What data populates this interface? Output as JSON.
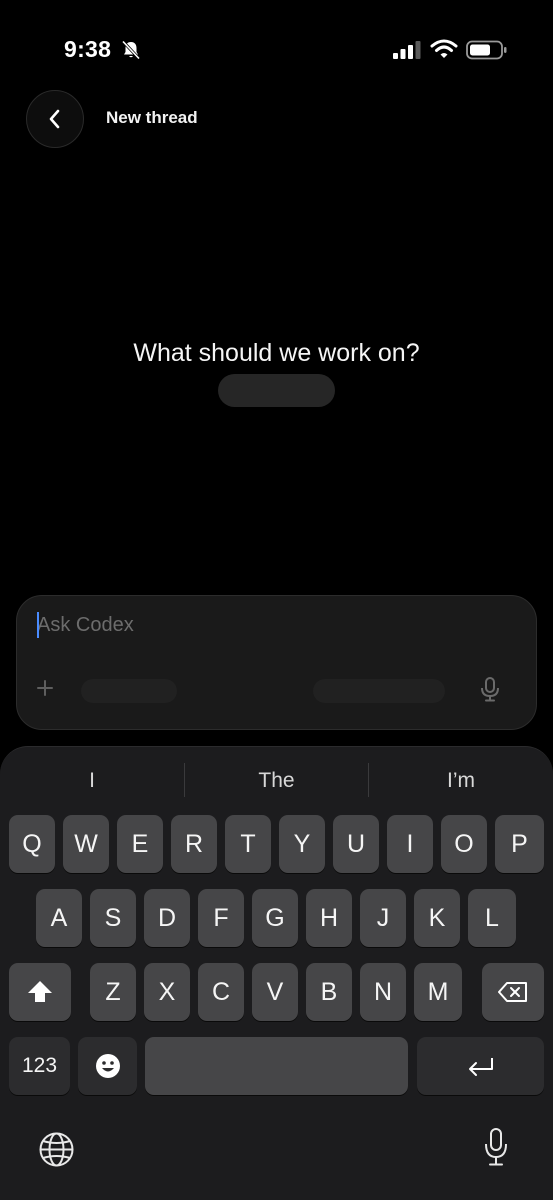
{
  "status_bar": {
    "time": "9:38",
    "icons": [
      "bell-slash-icon",
      "cellular-signal-icon",
      "wifi-icon",
      "battery-icon"
    ]
  },
  "header": {
    "back_icon": "chevron-left-icon",
    "title": "New thread"
  },
  "main": {
    "prompt": "What should we work on?"
  },
  "composer": {
    "placeholder": "Ask Codex",
    "value": "",
    "icons": [
      "plus-icon",
      "microphone-icon"
    ]
  },
  "keyboard": {
    "suggestions": [
      "I",
      "The",
      "I’m"
    ],
    "row1": [
      "Q",
      "W",
      "E",
      "R",
      "T",
      "Y",
      "U",
      "I",
      "O",
      "P"
    ],
    "row2": [
      "A",
      "S",
      "D",
      "F",
      "G",
      "H",
      "J",
      "K",
      "L"
    ],
    "row3": [
      "Z",
      "X",
      "C",
      "V",
      "B",
      "N",
      "M"
    ],
    "numbers_key": "123",
    "icons": [
      "shift-icon",
      "delete-icon",
      "emoji-icon",
      "return-icon",
      "globe-icon",
      "dictation-icon"
    ]
  },
  "colors": {
    "background": "#000000",
    "keyboard_bg": "#1c1c1e",
    "key_bg": "#464648",
    "caret": "#4a8cff"
  }
}
